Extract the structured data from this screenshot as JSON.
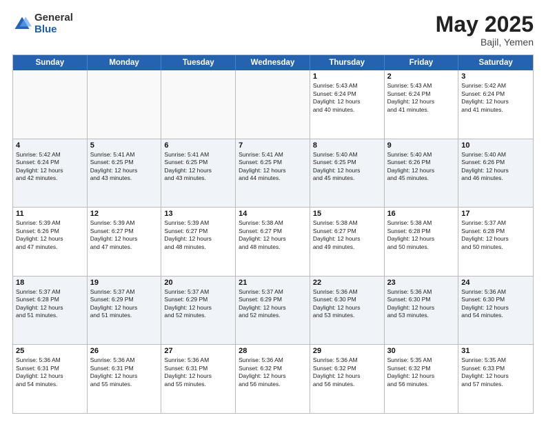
{
  "logo": {
    "general": "General",
    "blue": "Blue"
  },
  "title": "May 2025",
  "location": "Bajil, Yemen",
  "header": {
    "days": [
      "Sunday",
      "Monday",
      "Tuesday",
      "Wednesday",
      "Thursday",
      "Friday",
      "Saturday"
    ]
  },
  "weeks": [
    [
      {
        "day": "",
        "info": ""
      },
      {
        "day": "",
        "info": ""
      },
      {
        "day": "",
        "info": ""
      },
      {
        "day": "",
        "info": ""
      },
      {
        "day": "1",
        "info": "Sunrise: 5:43 AM\nSunset: 6:24 PM\nDaylight: 12 hours\nand 40 minutes."
      },
      {
        "day": "2",
        "info": "Sunrise: 5:43 AM\nSunset: 6:24 PM\nDaylight: 12 hours\nand 41 minutes."
      },
      {
        "day": "3",
        "info": "Sunrise: 5:42 AM\nSunset: 6:24 PM\nDaylight: 12 hours\nand 41 minutes."
      }
    ],
    [
      {
        "day": "4",
        "info": "Sunrise: 5:42 AM\nSunset: 6:24 PM\nDaylight: 12 hours\nand 42 minutes."
      },
      {
        "day": "5",
        "info": "Sunrise: 5:41 AM\nSunset: 6:25 PM\nDaylight: 12 hours\nand 43 minutes."
      },
      {
        "day": "6",
        "info": "Sunrise: 5:41 AM\nSunset: 6:25 PM\nDaylight: 12 hours\nand 43 minutes."
      },
      {
        "day": "7",
        "info": "Sunrise: 5:41 AM\nSunset: 6:25 PM\nDaylight: 12 hours\nand 44 minutes."
      },
      {
        "day": "8",
        "info": "Sunrise: 5:40 AM\nSunset: 6:25 PM\nDaylight: 12 hours\nand 45 minutes."
      },
      {
        "day": "9",
        "info": "Sunrise: 5:40 AM\nSunset: 6:26 PM\nDaylight: 12 hours\nand 45 minutes."
      },
      {
        "day": "10",
        "info": "Sunrise: 5:40 AM\nSunset: 6:26 PM\nDaylight: 12 hours\nand 46 minutes."
      }
    ],
    [
      {
        "day": "11",
        "info": "Sunrise: 5:39 AM\nSunset: 6:26 PM\nDaylight: 12 hours\nand 47 minutes."
      },
      {
        "day": "12",
        "info": "Sunrise: 5:39 AM\nSunset: 6:27 PM\nDaylight: 12 hours\nand 47 minutes."
      },
      {
        "day": "13",
        "info": "Sunrise: 5:39 AM\nSunset: 6:27 PM\nDaylight: 12 hours\nand 48 minutes."
      },
      {
        "day": "14",
        "info": "Sunrise: 5:38 AM\nSunset: 6:27 PM\nDaylight: 12 hours\nand 48 minutes."
      },
      {
        "day": "15",
        "info": "Sunrise: 5:38 AM\nSunset: 6:27 PM\nDaylight: 12 hours\nand 49 minutes."
      },
      {
        "day": "16",
        "info": "Sunrise: 5:38 AM\nSunset: 6:28 PM\nDaylight: 12 hours\nand 50 minutes."
      },
      {
        "day": "17",
        "info": "Sunrise: 5:37 AM\nSunset: 6:28 PM\nDaylight: 12 hours\nand 50 minutes."
      }
    ],
    [
      {
        "day": "18",
        "info": "Sunrise: 5:37 AM\nSunset: 6:28 PM\nDaylight: 12 hours\nand 51 minutes."
      },
      {
        "day": "19",
        "info": "Sunrise: 5:37 AM\nSunset: 6:29 PM\nDaylight: 12 hours\nand 51 minutes."
      },
      {
        "day": "20",
        "info": "Sunrise: 5:37 AM\nSunset: 6:29 PM\nDaylight: 12 hours\nand 52 minutes."
      },
      {
        "day": "21",
        "info": "Sunrise: 5:37 AM\nSunset: 6:29 PM\nDaylight: 12 hours\nand 52 minutes."
      },
      {
        "day": "22",
        "info": "Sunrise: 5:36 AM\nSunset: 6:30 PM\nDaylight: 12 hours\nand 53 minutes."
      },
      {
        "day": "23",
        "info": "Sunrise: 5:36 AM\nSunset: 6:30 PM\nDaylight: 12 hours\nand 53 minutes."
      },
      {
        "day": "24",
        "info": "Sunrise: 5:36 AM\nSunset: 6:30 PM\nDaylight: 12 hours\nand 54 minutes."
      }
    ],
    [
      {
        "day": "25",
        "info": "Sunrise: 5:36 AM\nSunset: 6:31 PM\nDaylight: 12 hours\nand 54 minutes."
      },
      {
        "day": "26",
        "info": "Sunrise: 5:36 AM\nSunset: 6:31 PM\nDaylight: 12 hours\nand 55 minutes."
      },
      {
        "day": "27",
        "info": "Sunrise: 5:36 AM\nSunset: 6:31 PM\nDaylight: 12 hours\nand 55 minutes."
      },
      {
        "day": "28",
        "info": "Sunrise: 5:36 AM\nSunset: 6:32 PM\nDaylight: 12 hours\nand 56 minutes."
      },
      {
        "day": "29",
        "info": "Sunrise: 5:36 AM\nSunset: 6:32 PM\nDaylight: 12 hours\nand 56 minutes."
      },
      {
        "day": "30",
        "info": "Sunrise: 5:35 AM\nSunset: 6:32 PM\nDaylight: 12 hours\nand 56 minutes."
      },
      {
        "day": "31",
        "info": "Sunrise: 5:35 AM\nSunset: 6:33 PM\nDaylight: 12 hours\nand 57 minutes."
      }
    ]
  ]
}
